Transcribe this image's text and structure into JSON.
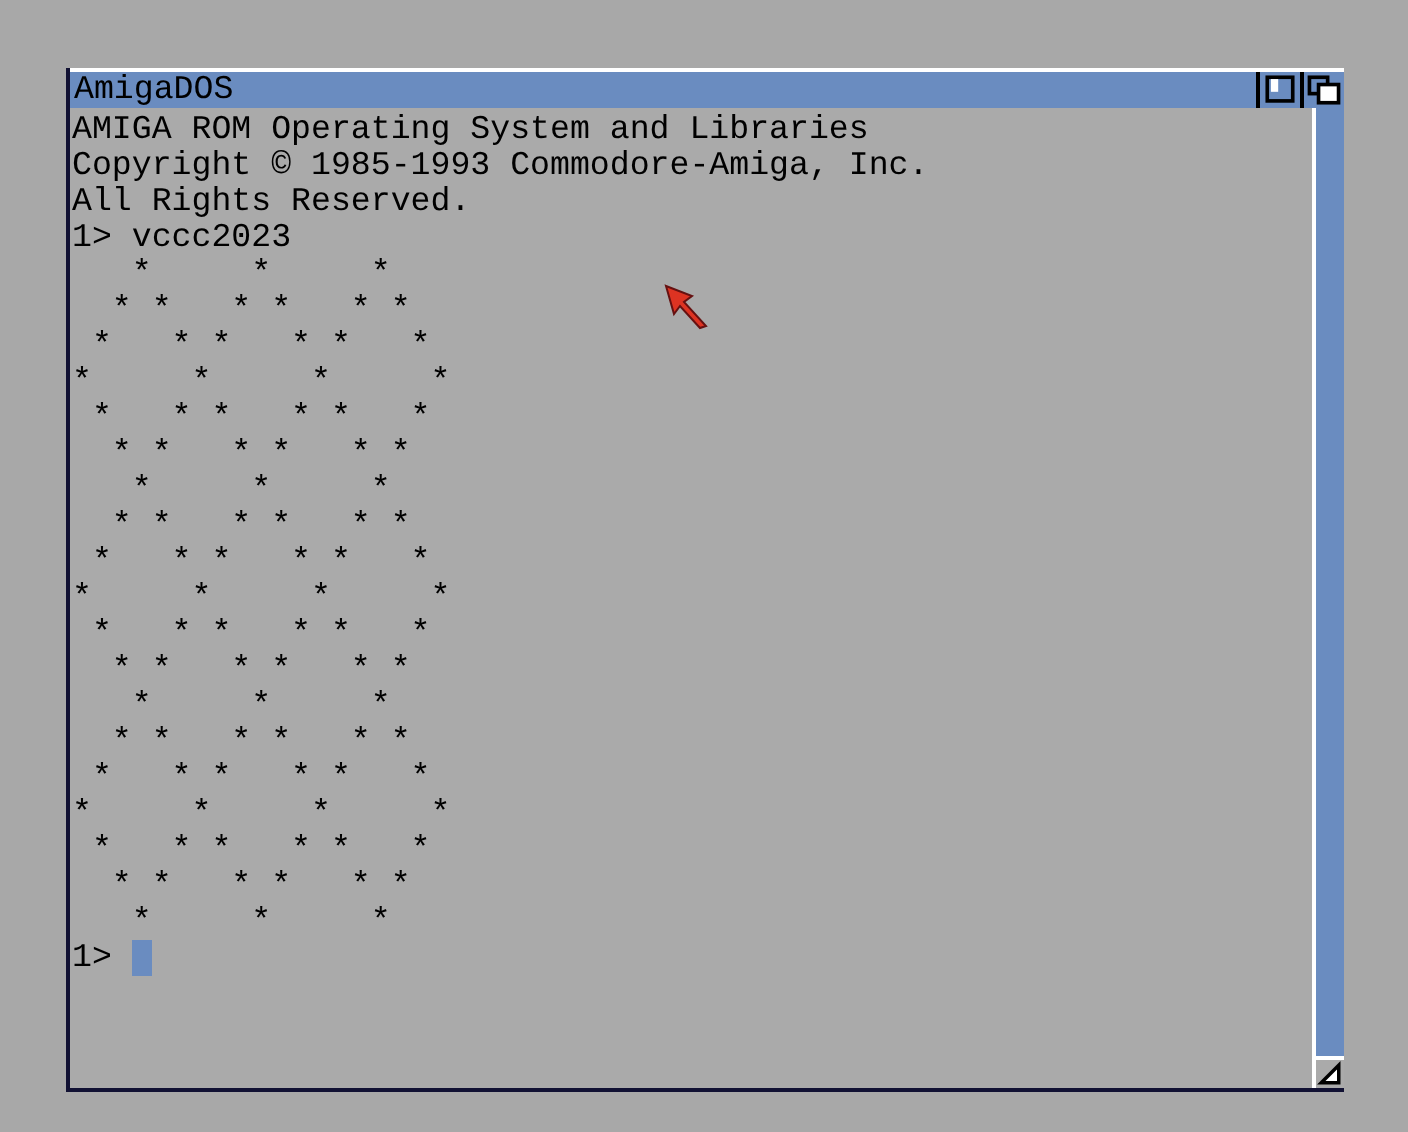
{
  "window": {
    "title": "AmigaDOS"
  },
  "console_lines": [
    "AMIGA ROM Operating System and Libraries",
    "Copyright © 1985-1993 Commodore-Amiga, Inc.",
    "All Rights Reserved.",
    "1> vccc2023"
  ],
  "ascii_art": "   *     *     *\n  * *   * *   * *\n *   * *   * *   *\n*     *     *     *\n *   * *   * *   *\n  * *   * *   * *\n   *     *     *\n  * *   * *   * *\n *   * *   * *   *\n*     *     *     *\n *   * *   * *   *\n  * *   * *   * *\n   *     *     *\n  * *   * *   * *\n *   * *   * *   *\n*     *     *     *\n *   * *   * *   *\n  * *   * *   * *\n   *     *     *",
  "prompt": {
    "text": "1>",
    "cursor": true
  }
}
